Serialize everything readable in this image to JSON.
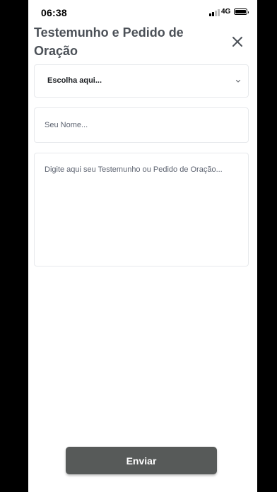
{
  "status_bar": {
    "time": "06:38",
    "network": "4G"
  },
  "header": {
    "title": "Testemunho e Pedido de Oração",
    "close_icon": "close-icon"
  },
  "form": {
    "type_select": {
      "value": "Escolha aqui...",
      "icon": "chevron-down-icon"
    },
    "name_input": {
      "placeholder": "Seu Nome...",
      "value": ""
    },
    "message_input": {
      "placeholder": "Digite aqui seu Testemunho ou Pedido de Oração...",
      "value": ""
    },
    "submit_label": "Enviar"
  },
  "colors": {
    "title": "#4b5057",
    "button_bg": "#575a59",
    "field_border": "#e7e9ec",
    "placeholder": "#5d6370"
  }
}
